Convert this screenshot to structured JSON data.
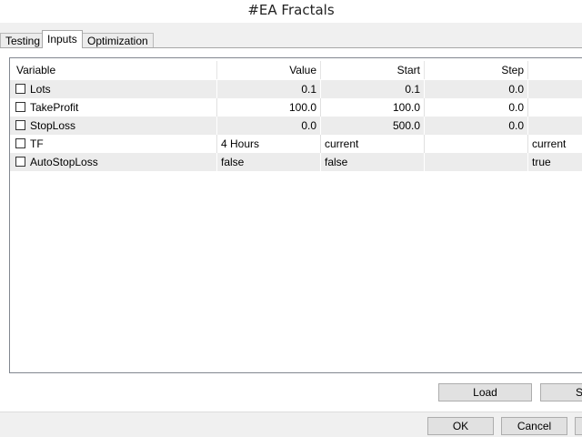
{
  "window": {
    "title": "#EA Fractals"
  },
  "tabs": [
    {
      "label": "Testing"
    },
    {
      "label": "Inputs",
      "active": true
    },
    {
      "label": "Optimization"
    }
  ],
  "table": {
    "columns": [
      "Variable",
      "Value",
      "Start",
      "Step",
      ""
    ],
    "rows": [
      {
        "checked": false,
        "variable": "Lots",
        "value": "0.1",
        "start": "0.1",
        "step": "0.0",
        "stop": ""
      },
      {
        "checked": false,
        "variable": "TakeProfit",
        "value": "100.0",
        "start": "100.0",
        "step": "0.0",
        "stop": ""
      },
      {
        "checked": false,
        "variable": "StopLoss",
        "value": "0.0",
        "start": "500.0",
        "step": "0.0",
        "stop": ""
      },
      {
        "checked": false,
        "variable": "TF",
        "value": "4 Hours",
        "start": "current",
        "step": "",
        "stop": "current"
      },
      {
        "checked": false,
        "variable": "AutoStopLoss",
        "value": "false",
        "start": "false",
        "step": "",
        "stop": "true"
      }
    ]
  },
  "buttons": {
    "load": "Load",
    "save": "S",
    "ok": "OK",
    "cancel": "Cancel"
  }
}
